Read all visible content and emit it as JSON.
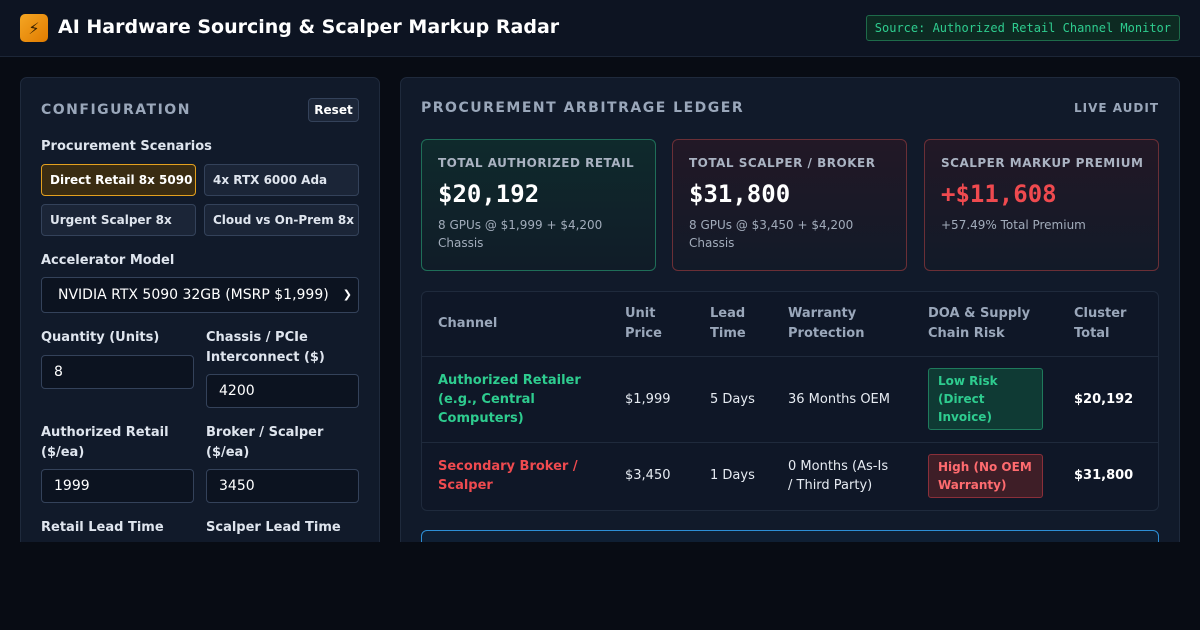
{
  "header": {
    "logo_glyph": "⚡",
    "title": "AI Hardware Sourcing & Scalper Markup Radar",
    "source": "Source: Authorized Retail Channel Monitor"
  },
  "config": {
    "title": "CONFIGURATION",
    "reset_label": "Reset",
    "scenarios_label": "Procurement Scenarios",
    "scenarios": [
      {
        "label": "Direct Retail 8x 5090",
        "active": true
      },
      {
        "label": "4x RTX 6000 Ada",
        "active": false
      },
      {
        "label": "Urgent Scalper 8x",
        "active": false
      },
      {
        "label": "Cloud vs On-Prem 8x",
        "active": false
      }
    ],
    "model_label": "Accelerator Model",
    "model_value": "NVIDIA RTX 5090 32GB (MSRP $1,999)",
    "quantity_label": "Quantity (Units)",
    "quantity_value": "8",
    "chassis_label": "Chassis / PCIe Interconnect ($)",
    "chassis_value": "4200",
    "retail_label": "Authorized Retail ($/ea)",
    "retail_value": "1999",
    "scalper_label": "Broker / Scalper ($/ea)",
    "scalper_value": "3450",
    "retail_lead_label": "Retail Lead Time",
    "scalper_lead_label": "Scalper Lead Time"
  },
  "ledger": {
    "title": "PROCUREMENT ARBITRAGE LEDGER",
    "live_label": "LIVE AUDIT",
    "cards": [
      {
        "label": "TOTAL AUTHORIZED RETAIL",
        "value": "$20,192",
        "sub": "8 GPUs @ $1,999 + $4,200 Chassis"
      },
      {
        "label": "TOTAL SCALPER / BROKER",
        "value": "$31,800",
        "sub": "8 GPUs @ $3,450 + $4,200 Chassis"
      },
      {
        "label": "SCALPER MARKUP PREMIUM",
        "value": "+$11,608",
        "sub": "+57.49% Total Premium"
      }
    ],
    "columns": [
      "Channel",
      "Unit Price",
      "Lead Time",
      "Warranty Protection",
      "DOA & Supply Chain Risk",
      "Cluster Total"
    ],
    "rows": [
      {
        "channel": "Authorized Retailer (e.g., Central Computers)",
        "unit_price": "$1,999",
        "lead_time": "5 Days",
        "warranty": "36 Months OEM",
        "risk": "Low Risk (Direct Invoice)",
        "total": "$20,192"
      },
      {
        "channel": "Secondary Broker / Scalper",
        "unit_price": "$3,450",
        "lead_time": "1 Days",
        "warranty": "0 Months (As-Is / Third Party)",
        "risk": "High (No OEM Warranty)",
        "total": "$31,800"
      }
    ]
  }
}
